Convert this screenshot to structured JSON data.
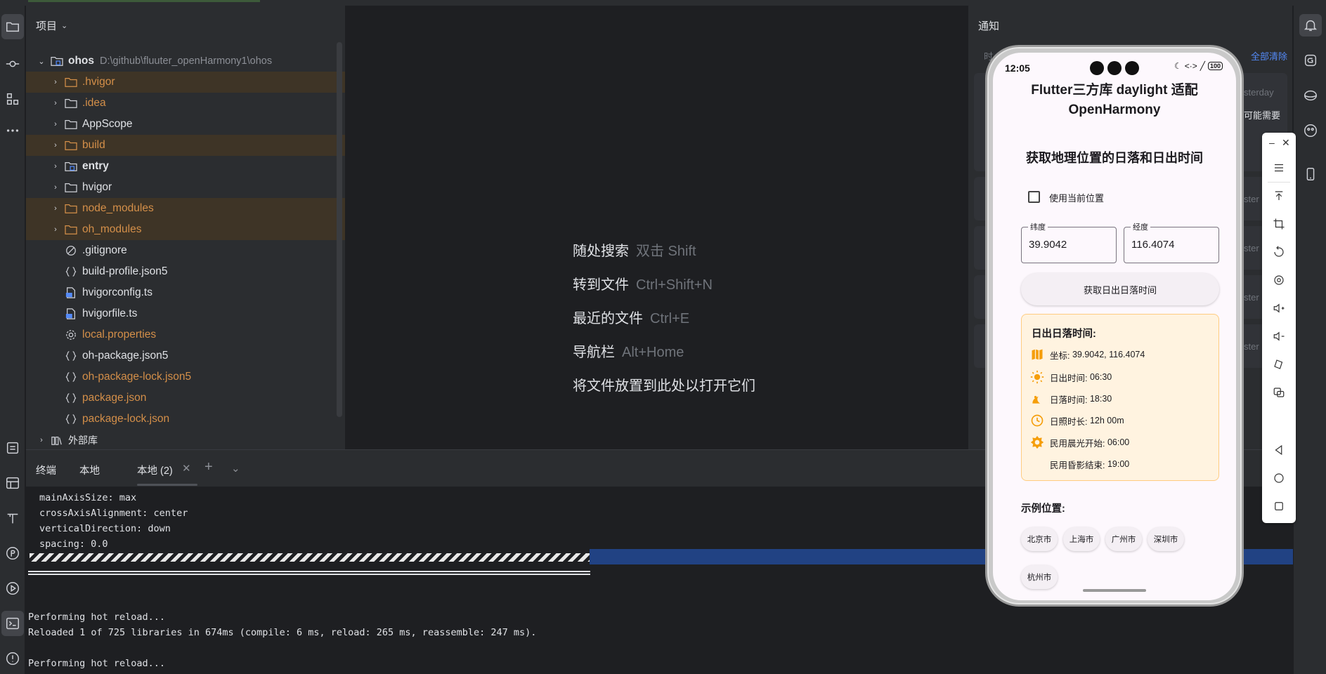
{
  "project_panel": {
    "header": "项目",
    "tree": [
      {
        "name": "ohos",
        "path": "D:\\github\\fluuter_openHarmony1\\ohos"
      },
      {
        "name": ".hvigor"
      },
      {
        "name": ".idea"
      },
      {
        "name": "AppScope"
      },
      {
        "name": "build"
      },
      {
        "name": "entry"
      },
      {
        "name": "hvigor"
      },
      {
        "name": "node_modules"
      },
      {
        "name": "oh_modules"
      },
      {
        "name": ".gitignore"
      },
      {
        "name": "build-profile.json5"
      },
      {
        "name": "hvigorconfig.ts"
      },
      {
        "name": "hvigorfile.ts"
      },
      {
        "name": "local.properties"
      },
      {
        "name": "oh-package.json5"
      },
      {
        "name": "oh-package-lock.json5"
      },
      {
        "name": "package.json"
      },
      {
        "name": "package-lock.json"
      },
      {
        "name": "外部库"
      }
    ]
  },
  "editor": {
    "hints": [
      {
        "label": "随处搜索",
        "key": "双击 Shift"
      },
      {
        "label": "转到文件",
        "key": "Ctrl+Shift+N"
      },
      {
        "label": "最近的文件",
        "key": "Ctrl+E"
      },
      {
        "label": "导航栏",
        "key": "Alt+Home"
      },
      {
        "label": "将文件放置到此处以打开它们",
        "key": ""
      }
    ]
  },
  "notifications": {
    "title": "通知",
    "clear_all": "全部清除",
    "time_prefix": "时",
    "side_texts": [
      "sterday",
      "可能需要",
      "ster",
      "ster",
      "ster",
      "ster"
    ]
  },
  "terminal": {
    "tabs": [
      "终端",
      "本地",
      "本地 (2)"
    ],
    "lines": [
      "mainAxisSize: max",
      "crossAxisAlignment: center",
      "verticalDirection: down",
      "spacing: 0.0"
    ],
    "log": [
      "Performing hot reload...",
      "Reloaded 1 of 725 libraries in 674ms (compile: 6 ms, reload: 265 ms, reassemble: 247 ms).",
      "",
      "Performing hot reload..."
    ]
  },
  "device": {
    "status": {
      "time": "12:05",
      "battery": "100"
    },
    "app_title_line1": "Flutter三方库 daylight 适配",
    "app_title_line2": "OpenHarmony",
    "section_title": "获取地理位置的日落和日出时间",
    "use_current_location": "使用当前位置",
    "use_current_location_checked": false,
    "latitude": {
      "label": "纬度",
      "value": "39.9042"
    },
    "longitude": {
      "label": "经度",
      "value": "116.4074"
    },
    "get_button": "获取日出日落时间",
    "result": {
      "title": "日出日落时间:",
      "rows": [
        {
          "icon": "map-icon",
          "label": "坐标:",
          "value": "39.9042, 116.4074"
        },
        {
          "icon": "sun-icon",
          "label": "日出时间:",
          "value": "06:30"
        },
        {
          "icon": "sunset-icon",
          "label": "日落时间:",
          "value": "18:30"
        },
        {
          "icon": "clock-icon",
          "label": "日照时长:",
          "value": "12h 00m"
        },
        {
          "icon": "sun-outline-icon",
          "label": "民用晨光开始:",
          "value": "06:00"
        },
        {
          "icon": "moon-icon",
          "label": "民用昏影结束:",
          "value": "19:00"
        }
      ]
    },
    "examples_title": "示例位置:",
    "examples": [
      "北京市",
      "上海市",
      "广州市",
      "深圳市",
      "杭州市"
    ]
  },
  "colors": {
    "ide_bg": "#1e1f22",
    "panel_bg": "#2b2d30",
    "highlight_row": "#3e3426",
    "orange_text": "#d48f49",
    "link_blue": "#548af7",
    "result_card_bg": "#fff3e0",
    "result_card_border": "#ffcc80",
    "icon_orange": "#f59e0b"
  }
}
